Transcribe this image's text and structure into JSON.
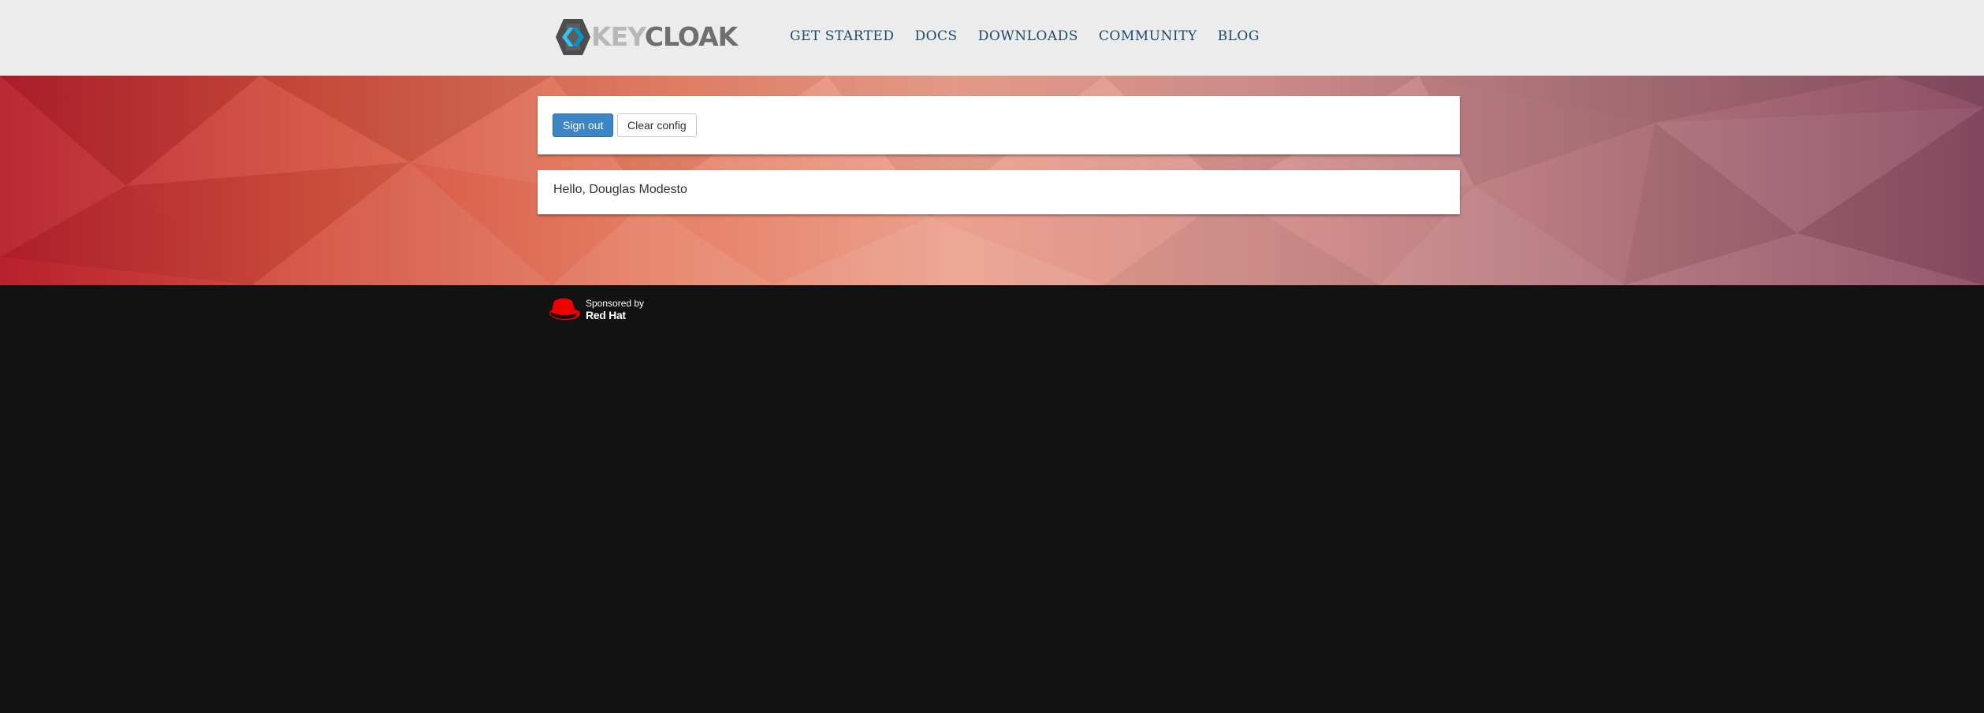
{
  "header": {
    "logo": {
      "part1": "KEY",
      "part2": "CLOAK",
      "icon": "keycloak-logo-icon"
    },
    "nav": [
      "GET STARTED",
      "DOCS",
      "DOWNLOADS",
      "COMMUNITY",
      "BLOG"
    ]
  },
  "actions": {
    "sign_out": "Sign out",
    "clear_config": "Clear config"
  },
  "greeting": "Hello, Douglas Modesto",
  "footer": {
    "sponsored_by": "Sponsored by",
    "brand": "Red Hat",
    "icon": "redhat-hat-icon"
  },
  "colors": {
    "topbar": "#ececec",
    "nav_link": "#1d4a6a",
    "primary_button": "#3c86c6",
    "footer_bg": "#121212",
    "redhat_red": "#ee0000"
  }
}
